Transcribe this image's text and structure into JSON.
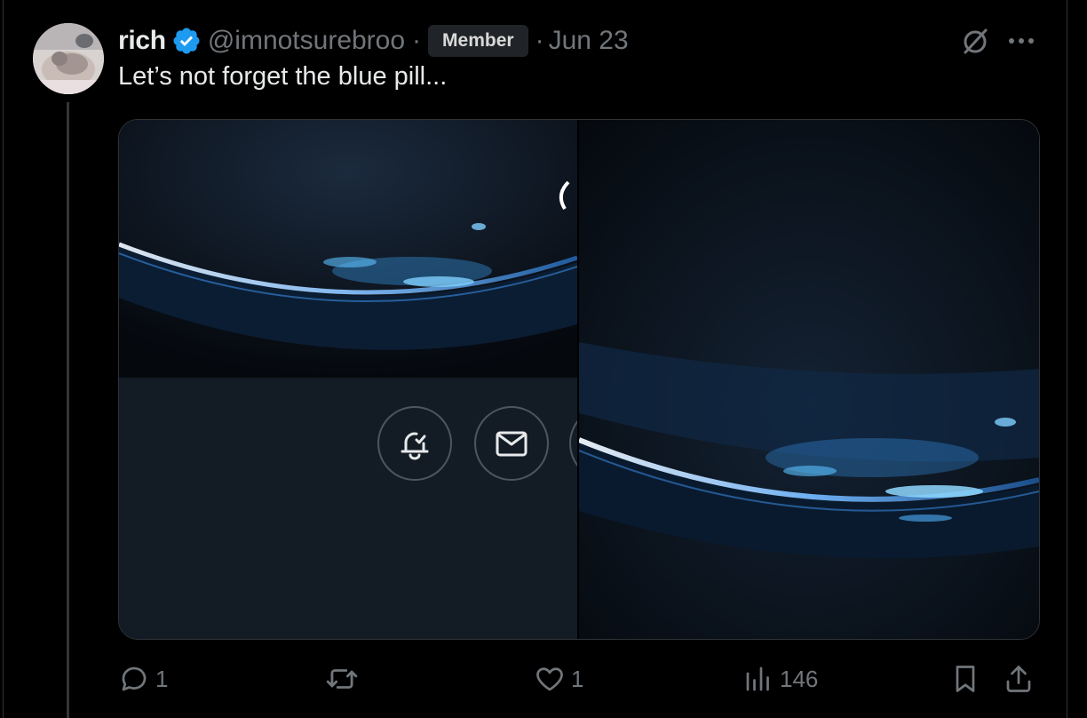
{
  "post": {
    "author_name": "rich",
    "handle": "@imnotsurebroo",
    "separator": "·",
    "badge": "Member",
    "date": "Jun 23",
    "text": "Let’s not forget the blue pill..."
  },
  "icons": {
    "verified": "verified-badge-icon",
    "grok": "grok-icon",
    "more": "more-options-icon",
    "notification": "bell-check-icon",
    "message": "envelope-icon"
  },
  "actions": {
    "reply_count": "1",
    "retweet_count": "",
    "like_count": "1",
    "views_count": "146"
  },
  "colors": {
    "background": "#000000",
    "text_primary": "#e7e9ea",
    "text_secondary": "#71767b",
    "verified": "#1d9bf0",
    "badge_bg": "#202327"
  }
}
